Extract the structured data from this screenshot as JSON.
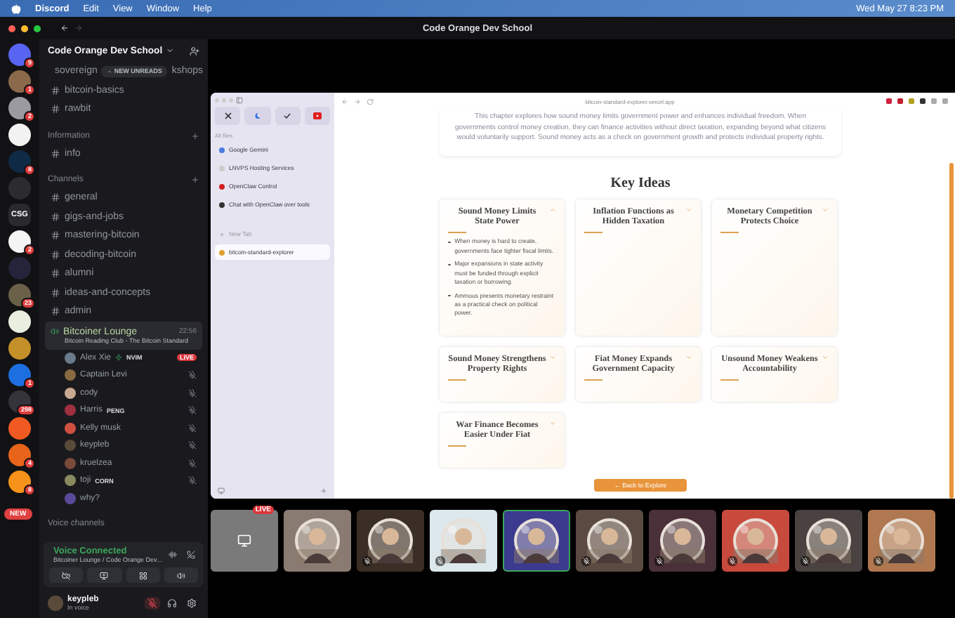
{
  "menu_bar": {
    "app": "Discord",
    "items": [
      "Edit",
      "View",
      "Window",
      "Help"
    ],
    "clock": "Wed May 27  8:23 PM"
  },
  "window": {
    "title": "Code Orange Dev School"
  },
  "servers": [
    {
      "color": "#5865f2",
      "badge": "9"
    },
    {
      "color": "#8a6a4a",
      "badge": "1"
    },
    {
      "color": "#9a9aa0",
      "badge": "2"
    },
    {
      "color": "#f2f2f2"
    },
    {
      "color": "#0e2a44",
      "badge": "8"
    },
    {
      "color": "#2c2c30"
    },
    {
      "color": "#2a2a2e",
      "label": "CSG"
    },
    {
      "color": "#f4f4f4",
      "badge": "2"
    },
    {
      "color": "#24243a"
    },
    {
      "color": "#6a6048",
      "badge": "23"
    },
    {
      "color": "#e8efe0"
    },
    {
      "color": "#c4902a"
    },
    {
      "color": "#1d6fe0",
      "badge": "1"
    },
    {
      "color": "#34343a",
      "badge": "298"
    },
    {
      "color": "#f05a22"
    },
    {
      "color": "#e8641a",
      "badge": "4"
    },
    {
      "color": "#f7931a",
      "badge": "8"
    }
  ],
  "new_pill": "NEW",
  "server_header": {
    "name": "Code Orange Dev School"
  },
  "channels_top": [
    {
      "name": "sovereign",
      "name_tail": "kshops"
    },
    {
      "name": "bitcoin-basics"
    },
    {
      "name": "rawbit"
    }
  ],
  "new_unreads": "NEW UNREADS",
  "categories": [
    {
      "name": "Information",
      "channels": [
        {
          "name": "info"
        }
      ]
    },
    {
      "name": "Channels",
      "channels": [
        {
          "name": "general"
        },
        {
          "name": "gigs-and-jobs"
        },
        {
          "name": "mastering-bitcoin"
        },
        {
          "name": "decoding-bitcoin"
        },
        {
          "name": "alumni"
        },
        {
          "name": "ideas-and-concepts"
        },
        {
          "name": "admin"
        }
      ]
    }
  ],
  "voice_channel": {
    "name": "Bitcoiner Lounge",
    "time": "22:56",
    "topic": "Bitcoin Reading Club - The Bitcoin Standard"
  },
  "members": [
    {
      "name": "Alex Xie",
      "tag": "NVIM",
      "live_badge": "LIVE",
      "muted": false,
      "color": "#6a7a8a"
    },
    {
      "name": "Captain Levi",
      "muted": true,
      "color": "#8a6a40"
    },
    {
      "name": "cody",
      "muted": true,
      "color": "#c8a890"
    },
    {
      "name": "Harris",
      "tag": "PENG",
      "muted": true,
      "color": "#a03040"
    },
    {
      "name": "Kelly musk",
      "muted": true,
      "color": "#d05040"
    },
    {
      "name": "keypleb",
      "muted": true,
      "color": "#5a4a3a"
    },
    {
      "name": "kruelzea",
      "muted": true,
      "color": "#7a4a3a"
    },
    {
      "name": "toji",
      "tag": "CORN",
      "muted": true,
      "color": "#8a8a60"
    },
    {
      "name": "why?",
      "muted": false,
      "color": "#5a4a9a"
    }
  ],
  "voice_channels_label": "Voice channels",
  "voice_panel": {
    "status": "Voice Connected",
    "location": "Bitcoiner Lounge / Code Orange Dev..."
  },
  "user": {
    "name": "keypleb",
    "status": "In voice",
    "mic_muted": true
  },
  "browser": {
    "sidebar_label": "All files",
    "tabs": [
      {
        "title": "Google Gemini",
        "selected": false
      },
      {
        "title": "LNVPS Hosting Services",
        "selected": false
      },
      {
        "title": "OpenClaw Control",
        "selected": false
      },
      {
        "title": "Chat with OpenClaw over tools",
        "selected": false
      }
    ],
    "new_tab": "New Tab",
    "open_tabs": [
      {
        "title": "bitcoin-standard-explorer",
        "selected": true
      }
    ],
    "url": "bitcoin-standard-explorer.vercel.app",
    "intro": "This chapter explores how sound money limits government power and enhances individual freedom. When governments control money creation, they can finance activities without direct taxation, expanding beyond what citizens would voluntarily support. Sound money acts as a check on government growth and protects individual property rights.",
    "heading": "Key Ideas",
    "ideas": [
      {
        "title": "Sound Money Limits State Power",
        "expanded": true,
        "points": [
          "When money is hard to create, governments face tighter fiscal limits.",
          "Major expansions in state activity must be funded through explicit taxation or borrowing.",
          "Ammous presents monetary restraint as a practical check on political power."
        ]
      },
      {
        "title": "Inflation Functions as Hidden Taxation",
        "expanded": false
      },
      {
        "title": "Monetary Competition Protects Choice",
        "expanded": false
      },
      {
        "title": "Sound Money Strengthens Property Rights",
        "expanded": false
      },
      {
        "title": "Fiat Money Expands Government Capacity",
        "expanded": false
      },
      {
        "title": "Unsound Money Weakens Accountability",
        "expanded": false
      },
      {
        "title": "War Finance Becomes Easier Under Fiat",
        "expanded": false
      }
    ],
    "back_button": "← Back to Explore"
  },
  "tiles": [
    {
      "kind": "screen",
      "live_badge": "LIVE",
      "muted": false,
      "speaking": false,
      "color": "#7a7a7a"
    },
    {
      "kind": "avatar",
      "muted": false,
      "speaking": false,
      "color": "#8a7b72"
    },
    {
      "kind": "avatar",
      "muted": true,
      "speaking": false,
      "color": "#3a2e26"
    },
    {
      "kind": "avatar",
      "muted": true,
      "speaking": false,
      "color": "#dde8ec"
    },
    {
      "kind": "avatar",
      "muted": false,
      "speaking": true,
      "color": "#3b3a8e"
    },
    {
      "kind": "avatar",
      "muted": true,
      "speaking": false,
      "color": "#5a4a42"
    },
    {
      "kind": "avatar",
      "muted": true,
      "speaking": false,
      "color": "#4a3038"
    },
    {
      "kind": "avatar",
      "muted": true,
      "speaking": false,
      "color": "#c84a3c"
    },
    {
      "kind": "avatar",
      "muted": true,
      "speaking": false,
      "color": "#4a4240"
    },
    {
      "kind": "avatar",
      "muted": true,
      "speaking": false,
      "color": "#b07850"
    }
  ]
}
